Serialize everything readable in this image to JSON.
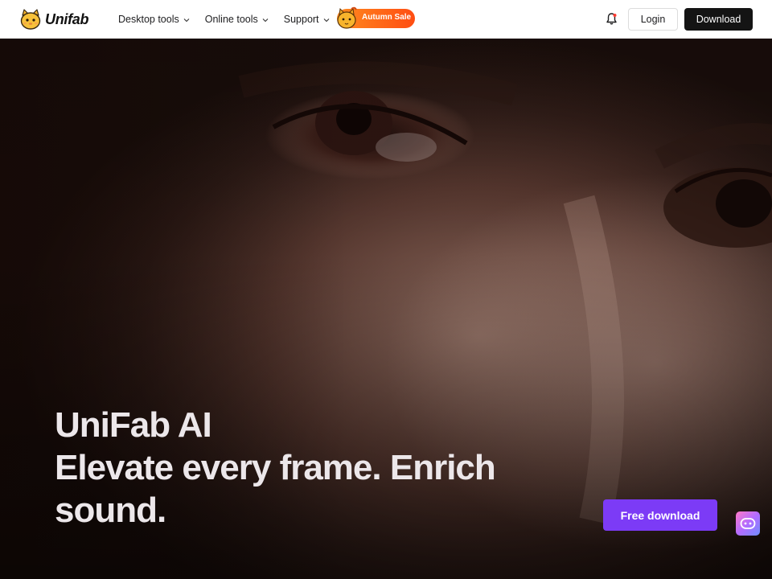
{
  "header": {
    "brand_name": "Unifab",
    "logo_icon": "cat-mascot-icon",
    "nav": [
      {
        "label": "Desktop tools",
        "icon": "chevron-down-icon"
      },
      {
        "label": "Online tools",
        "icon": "chevron-down-icon"
      },
      {
        "label": "Support",
        "icon": "chevron-down-icon"
      }
    ],
    "sale_label": "Autumn Sale",
    "notification_icon": "bell-icon",
    "login_label": "Login",
    "download_label": "Download"
  },
  "hero": {
    "brand_line": "UniFab AI",
    "tagline": "Elevate every frame. Enrich sound.",
    "cta_label": "Free download",
    "chat_icon": "chatbot-icon"
  },
  "colors": {
    "header_bg": "#ffffff",
    "download_bg": "#141414",
    "sale_gradient_start": "#ff8a1f",
    "sale_gradient_end": "#ff4d12",
    "cta_bg": "#7c3bf6",
    "headline_text": "#ece7ea"
  }
}
